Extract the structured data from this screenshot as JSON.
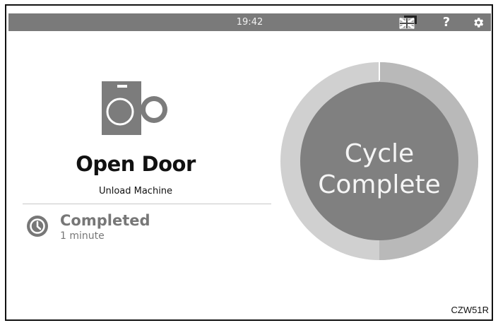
{
  "header": {
    "time": "19:42",
    "icons": [
      "language-flag-icon",
      "help-icon",
      "settings-gear-icon"
    ]
  },
  "status": {
    "door_message": "Open Door",
    "unload_message": "Unload Machine",
    "completion_label": "Completed",
    "completion_time": "1 minute"
  },
  "cycle": {
    "line1": "Cycle",
    "line2": "Complete"
  },
  "footer": {
    "code": "CZW51R"
  },
  "colors": {
    "topbar": "#7a7a7a",
    "ring_outer": "#cfcfcf",
    "ring_inner": "#7f7f7f",
    "icon_gray": "#7c7c7c"
  }
}
